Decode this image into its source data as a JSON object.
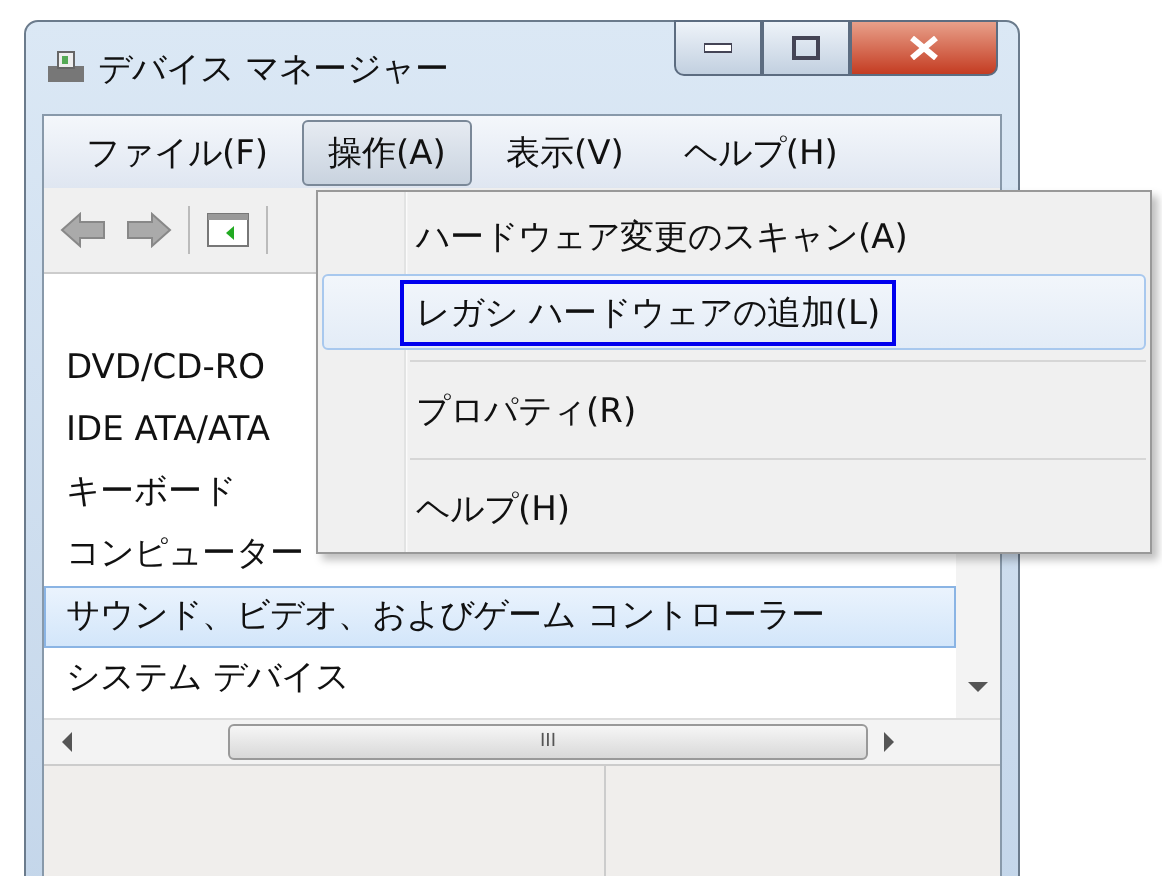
{
  "window": {
    "title": "デバイス マネージャー"
  },
  "menu_bar": [
    {
      "label": "ファイル(F)",
      "selected": false
    },
    {
      "label": "操作(A)",
      "selected": true
    },
    {
      "label": "表示(V)",
      "selected": false
    },
    {
      "label": "ヘルプ(H)",
      "selected": false
    }
  ],
  "tree": {
    "items": [
      {
        "label": "DVD/CD-RO",
        "selected": false
      },
      {
        "label": "IDE ATA/ATA",
        "selected": false
      },
      {
        "label": "キーボード",
        "selected": false
      },
      {
        "label": "コンピューター",
        "selected": false
      },
      {
        "label": "サウンド、ビデオ、およびゲーム コントローラー",
        "selected": true
      },
      {
        "label": "システム デバイス",
        "selected": false
      }
    ],
    "scrollbar_grip": "III"
  },
  "dropdown": {
    "items": [
      {
        "label": "ハードウェア変更のスキャン(A)",
        "selected": false
      },
      {
        "label": "レガシ ハードウェアの追加(L)",
        "selected": true
      },
      {
        "label": "プロパティ(R)",
        "selected": false
      },
      {
        "label": "ヘルプ(H)",
        "selected": false
      }
    ]
  }
}
